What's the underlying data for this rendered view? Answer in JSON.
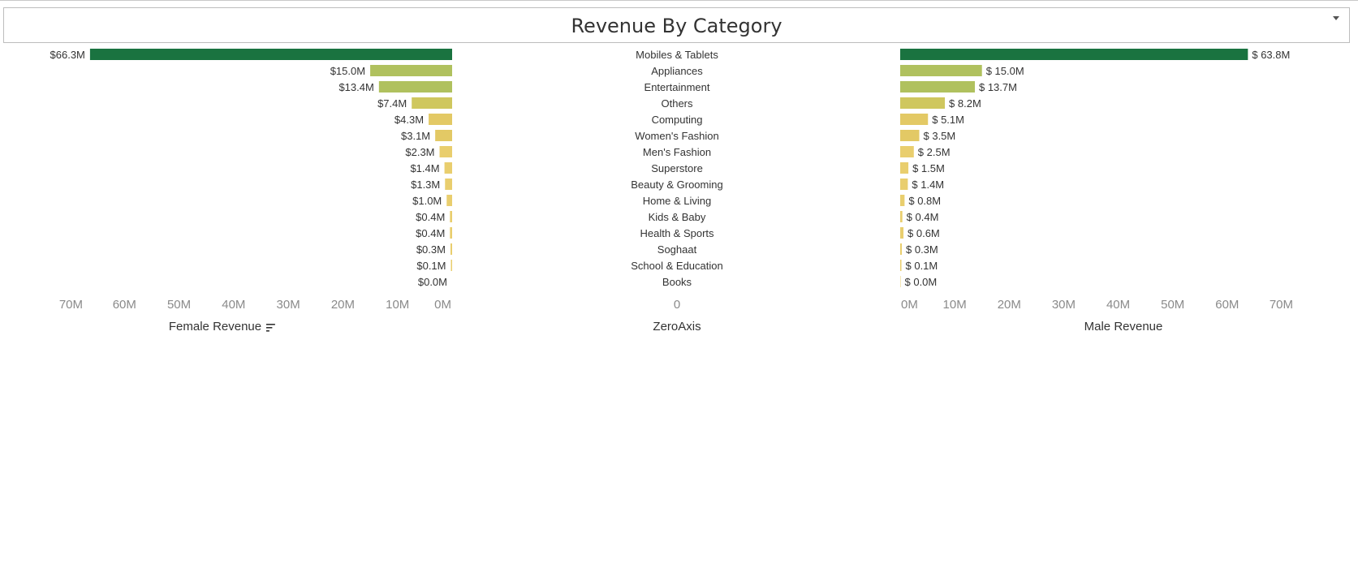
{
  "dashboard": {
    "title": "Revenue By Category"
  },
  "colors": {
    "dark_green": "#1a7340",
    "olive_green": "#b0c15e",
    "yellow_green": "#cfc75e",
    "mustard": "#e3c965",
    "pale_yellow": "#e9ce6e",
    "tick_text": "#8a8a8a",
    "label_text": "#333333"
  },
  "chart_data": [
    {
      "type": "bar",
      "orientation": "horizontal",
      "direction": "right-to-left",
      "xlabel": "Female Revenue",
      "sort_indicator": "sort-descending-icon",
      "xlim": [
        0,
        70
      ],
      "x_ticks": [
        "70M",
        "60M",
        "50M",
        "40M",
        "30M",
        "20M",
        "10M",
        "0M"
      ],
      "categories": [
        "Mobiles & Tablets",
        "Appliances",
        "Entertainment",
        "Others",
        "Computing",
        "Women's Fashion",
        "Men's Fashion",
        "Superstore",
        "Beauty & Grooming",
        "Home & Living",
        "Kids & Baby",
        "Health & Sports",
        "Soghaat",
        "School & Education",
        "Books"
      ],
      "values": [
        66.3,
        15.0,
        13.4,
        7.4,
        4.3,
        3.1,
        2.3,
        1.4,
        1.3,
        1.0,
        0.4,
        0.4,
        0.3,
        0.1,
        0.0
      ],
      "value_labels": [
        "$66.3M",
        "$15.0M",
        "$13.4M",
        "$7.4M",
        "$4.3M",
        "$3.1M",
        "$2.3M",
        "$1.4M",
        "$1.3M",
        "$1.0M",
        "$0.4M",
        "$0.4M",
        "$0.3M",
        "$0.1M",
        "$0.0M"
      ],
      "grid": false
    },
    {
      "type": "table",
      "xlabel": "ZeroAxis",
      "x_ticks": [
        "0"
      ],
      "row_labels": [
        "Mobiles & Tablets",
        "Appliances",
        "Entertainment",
        "Others",
        "Computing",
        "Women's Fashion",
        "Men's Fashion",
        "Superstore",
        "Beauty & Grooming",
        "Home & Living",
        "Kids & Baby",
        "Health & Sports",
        "Soghaat",
        "School & Education",
        "Books"
      ]
    },
    {
      "type": "bar",
      "orientation": "horizontal",
      "direction": "left-to-right",
      "xlabel": "Male Revenue",
      "xlim": [
        0,
        70
      ],
      "x_ticks": [
        "0M",
        "10M",
        "20M",
        "30M",
        "40M",
        "50M",
        "60M",
        "70M"
      ],
      "categories": [
        "Mobiles & Tablets",
        "Appliances",
        "Entertainment",
        "Others",
        "Computing",
        "Women's Fashion",
        "Men's Fashion",
        "Superstore",
        "Beauty & Grooming",
        "Home & Living",
        "Kids & Baby",
        "Health & Sports",
        "Soghaat",
        "School & Education",
        "Books"
      ],
      "values": [
        63.8,
        15.0,
        13.7,
        8.2,
        5.1,
        3.5,
        2.5,
        1.5,
        1.4,
        0.8,
        0.4,
        0.6,
        0.3,
        0.1,
        0.0
      ],
      "value_labels": [
        "$ 63.8M",
        "$ 15.0M",
        "$ 13.7M",
        "$ 8.2M",
        "$ 5.1M",
        "$ 3.5M",
        "$ 2.5M",
        "$ 1.5M",
        "$ 1.4M",
        "$ 0.8M",
        "$ 0.4M",
        "$ 0.6M",
        "$ 0.3M",
        "$ 0.1M",
        "$ 0.0M"
      ],
      "grid": false
    }
  ]
}
